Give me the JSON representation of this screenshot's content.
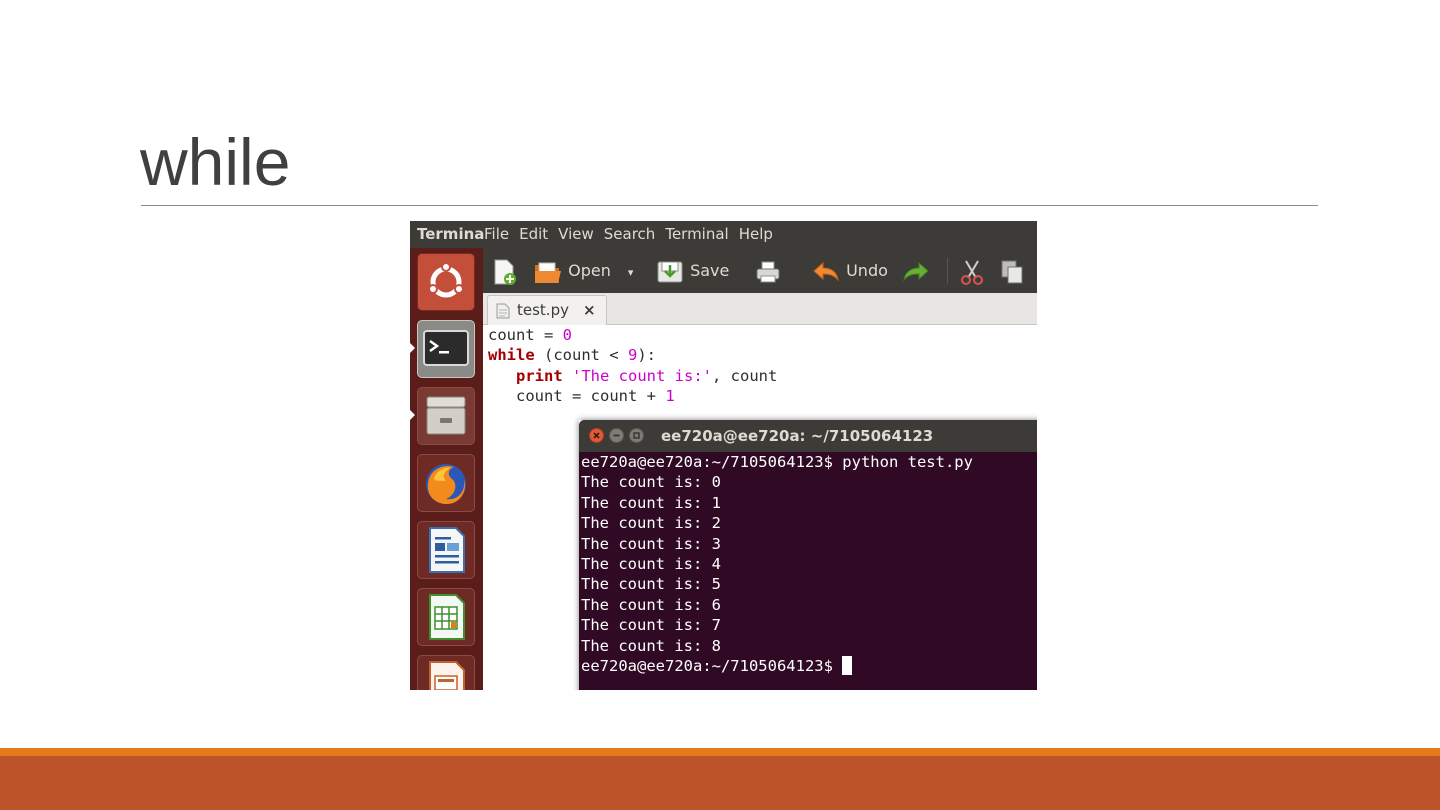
{
  "slide": {
    "title": "while"
  },
  "screenshot": {
    "menubar": {
      "app_name": "Terminal",
      "items": [
        "File",
        "Edit",
        "View",
        "Search",
        "Terminal",
        "Help"
      ]
    },
    "launcher": {
      "icons": [
        "ubuntu-dash-icon",
        "terminal-icon",
        "file-cabinet-icon",
        "firefox-icon",
        "writer-icon",
        "calc-icon",
        "impress-icon"
      ]
    },
    "toolbar": {
      "new_icon": "new-document-icon",
      "open_label": "Open",
      "save_label": "Save",
      "print_icon": "printer-icon",
      "undo_label": "Undo",
      "redo_icon": "redo-icon",
      "cut_icon": "scissors-icon",
      "copy_icon": "copy-icon"
    },
    "tab": {
      "label": "test.py",
      "close": "×"
    },
    "code": {
      "line1": {
        "ident": "count = ",
        "num": "0"
      },
      "line2": {
        "kw": "while",
        "a": " (count < ",
        "num": "9",
        "b": "):"
      },
      "line3": {
        "indent": "   ",
        "kw": "print",
        "sp": " ",
        "str": "'The count is:'",
        "rest": ", count"
      },
      "line4": {
        "indent": "   ",
        "a": "count = count + ",
        "num": "1"
      }
    },
    "terminal": {
      "title": "ee720a@ee720a: ~/7105064123",
      "lines": [
        "ee720a@ee720a:~/7105064123$ python test.py",
        "The count is: 0",
        "The count is: 1",
        "The count is: 2",
        "The count is: 3",
        "The count is: 4",
        "The count is: 5",
        "The count is: 6",
        "The count is: 7",
        "The count is: 8"
      ],
      "prompt": "ee720a@ee720a:~/7105064123$ "
    }
  },
  "colors": {
    "accent_orange": "#e47a1b",
    "footer_rust": "#bb5428",
    "terminal_bg": "#300a24",
    "launcher_bg": "#5a1d1a"
  }
}
